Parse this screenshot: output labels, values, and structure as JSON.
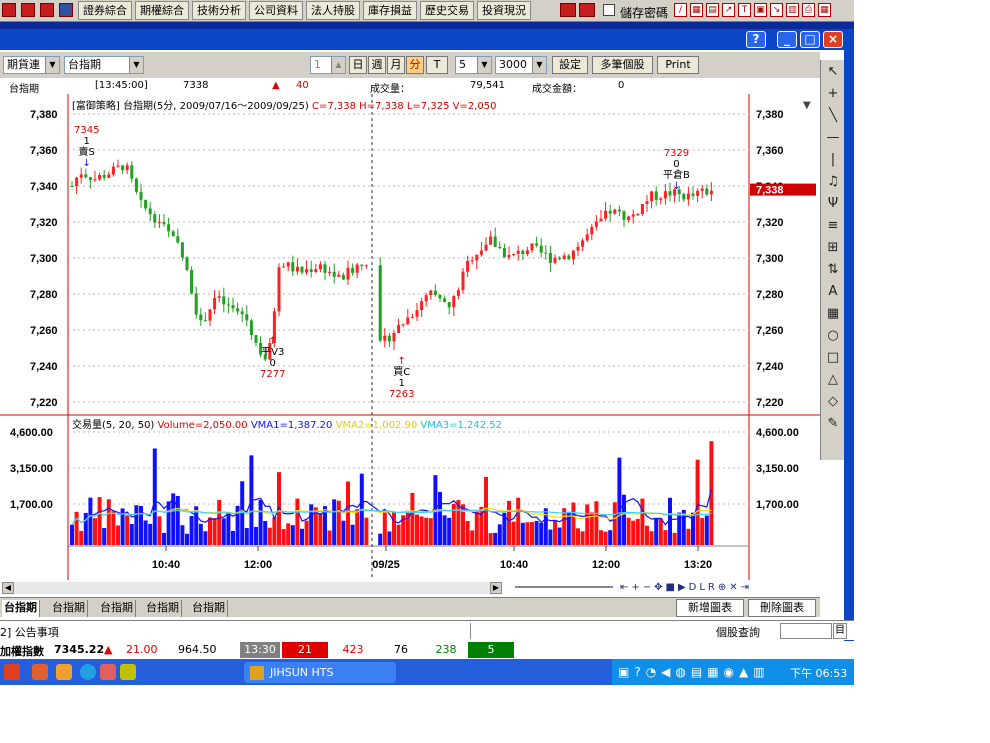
{
  "topbar": {
    "menu": [
      "證券綜合",
      "期權綜合",
      "技術分析",
      "公司資料",
      "法人持股",
      "庫存損益",
      "歷史交易",
      "投資現況"
    ],
    "save_password": "儲存密碼"
  },
  "toolbar": {
    "product_type": "期貨連",
    "product": "台指期",
    "day": "日",
    "week": "週",
    "month": "月",
    "minute": "分",
    "tick": "T",
    "interval": "5",
    "count": "3000",
    "settings": "設定",
    "multi": "多筆個股",
    "print": "Print"
  },
  "info": {
    "name": "台指期",
    "time": "[13:45:00]",
    "price": "7338",
    "arrow": "▲",
    "change": "40",
    "volume_label": "成交量：",
    "volume": "79,541",
    "amount_label": "成交金額：",
    "amount": "0"
  },
  "chart": {
    "title_strategy": "[富御策略]",
    "title_main": "台指期(5分, 2009/07/16～2009/09/25)",
    "title_ohlc": "C=7,338 H=7,338 L=7,325 V=2,050",
    "price_ticks": [
      "7,380",
      "7,360",
      "7,340",
      "7,320",
      "7,300",
      "7,280",
      "7,260",
      "7,240",
      "7,220"
    ],
    "current_price": "7,338",
    "vol_label": "交易量(5, 20, 50)",
    "vol_value": "Volume=2,050.00",
    "vma1": "VMA1=1,387.20",
    "vma2": "VMA2=1,002.90",
    "vma3": "VMA3=1,242.52",
    "vol_ticks": [
      "4,600.00",
      "3,150.00",
      "1,700.00"
    ],
    "time_ticks": [
      "10:40",
      "12:00",
      "09/25",
      "10:40",
      "12:00",
      "13:20"
    ],
    "signals": [
      {
        "name": "sell-s",
        "price": "7345",
        "count": "1",
        "label": "賣S"
      },
      {
        "name": "close-v3",
        "price": "7277",
        "count": "0",
        "label": "平V3"
      },
      {
        "name": "buy-c",
        "price": "7263",
        "count": "1",
        "label": "買C"
      },
      {
        "name": "close-b",
        "price": "7329",
        "count": "0",
        "label": "平倉B"
      }
    ],
    "colors": {
      "up": "#ff2020",
      "down": "#20a020",
      "vol_up": "#ff1010",
      "vol_down": "#1010ff",
      "vma1": "#1010ff",
      "vma2": "#ffe000",
      "vma3": "#40d0ff"
    }
  },
  "tabs": [
    "台指期",
    "台指期",
    "台指期",
    "台指期",
    "台指期"
  ],
  "buttons": {
    "new_chart": "新增圖表",
    "delete_chart": "刪除圖表"
  },
  "status": {
    "notice": "2] 公告事項",
    "stock_query": "個股查詢"
  },
  "ticker": {
    "name": "加權指數",
    "value": "7345.22",
    "arrow": "▲",
    "change": "21.00",
    "amount": "964.50",
    "time": "13:30",
    "up": "21",
    "up2": "423",
    "flat": "76",
    "down": "238",
    "down2": "5"
  },
  "taskbar": {
    "app": "JIHSUN HTS",
    "clock": "下午 06:53"
  }
}
